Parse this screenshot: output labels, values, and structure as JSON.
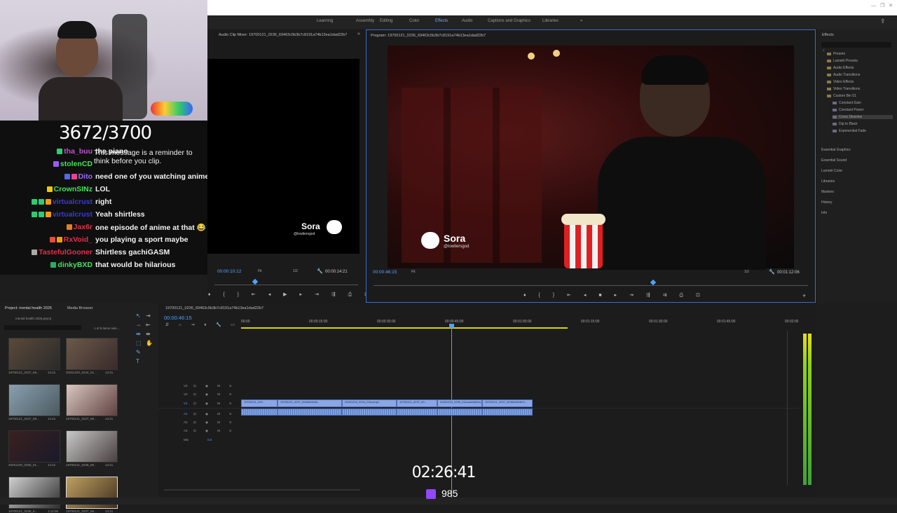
{
  "window": {
    "workspace_tabs": [
      "Learning",
      "Assembly",
      "Editing",
      "Color",
      "Effects",
      "Audio",
      "Captions and Graphics",
      "Libraries"
    ],
    "active_tab": "Effects",
    "more_label": "»"
  },
  "stream_overlay": {
    "follower_goal": "3672/3700",
    "uptime": "02:26:41",
    "viewers": "985"
  },
  "chat": [
    {
      "user": "tha_buu",
      "user_color": "#c44fd6",
      "message": "the piano",
      "badge_colors": [
        "#2ecc71"
      ]
    },
    {
      "user": "stolenCD",
      "user_color": "#42e35a",
      "message": "",
      "badge_colors": [
        "#9b59ff"
      ]
    },
    {
      "user": "Dito",
      "user_color": "#9b6bff",
      "message": "need one of you watching anime",
      "badge_colors": [
        "#5865f2",
        "#e84393"
      ]
    },
    {
      "user": "CrownSINz",
      "user_color": "#42e35a",
      "message": "LOL",
      "badge_colors": [
        "#f1c40f"
      ]
    },
    {
      "user": "virtualcrust",
      "user_color": "#3a3ad6",
      "message": "right",
      "badge_colors": [
        "#2ecc71",
        "#2ecc71",
        "#f39c12"
      ]
    },
    {
      "user": "virtualcrust",
      "user_color": "#3a3ad6",
      "message": "Yeah shirtless",
      "badge_colors": [
        "#2ecc71",
        "#2ecc71",
        "#f39c12"
      ]
    },
    {
      "user": "Jax6r",
      "user_color": "#e0304a",
      "message": "one episode of anime at that 😂",
      "badge_colors": [
        "#e67e22"
      ]
    },
    {
      "user": "RxVoid_",
      "user_color": "#e0304a",
      "message": "you playing a sport maybe",
      "badge_colors": [
        "#e74c3c",
        "#f39c12"
      ]
    },
    {
      "user": "TastefulGooner",
      "user_color": "#e0304a",
      "message": "Shirtless gachiGASM",
      "badge_colors": [
        "#aaaaaa"
      ]
    },
    {
      "user": "dinkyBXD",
      "user_color": "#42e35a",
      "message": "that would be hilarious",
      "badge_colors": [
        "#27ae60"
      ]
    }
  ],
  "chat_system_message": "This message is a reminder to think before you clip.",
  "source_monitor": {
    "title": "Audio Clip Mixer: 19700121_0236_69463c5b3b7c8191a74b13ea1dad22b7",
    "timecode": "00:00:10:12",
    "duration": "00:00:14:21",
    "zoom": "Fit",
    "quality": "1/2",
    "watermark_name": "Sora",
    "watermark_handle": "@lowtiersgod"
  },
  "program_monitor": {
    "title": "Program: 19700121_0236_69463c5b3b7c8191a74b13ea1dad22b7",
    "timecode": "00:00:46:15",
    "duration": "00:01:12:06",
    "zoom": "Fit",
    "quality": "1/2",
    "watermark_name": "Sora",
    "watermark_handle": "@lowtiersgod"
  },
  "effects_panel": {
    "title": "Effects",
    "tree": [
      "Presets",
      "Lumetri Presets",
      "Audio Effects",
      "Audio Transitions",
      "Video Effects",
      "Video Transitions",
      "Custom Bin 01",
      "Constant Gain",
      "Constant Power",
      "Cross Dissolve",
      "Dip to Black",
      "Exponential Fade"
    ],
    "sections": [
      "Essential Graphics",
      "Essential Sound",
      "Lumetri Color",
      "Libraries",
      "Markers",
      "History",
      "Info"
    ]
  },
  "project_panel": {
    "tabs": [
      "Project: mental health 2025",
      "Media Browser"
    ],
    "path": "mental health 2025.prproj",
    "items_count": "1 of 8 items sele...",
    "items": [
      {
        "name": "19700121_0237_69...",
        "duration": "14:21",
        "colors": [
          "#5a4a3a",
          "#2a2a2a"
        ]
      },
      {
        "name": "20251220_0244_01...",
        "duration": "14:21",
        "colors": [
          "#6a5a4a",
          "#3a2a2a"
        ]
      },
      {
        "name": "19700121_0237_69...",
        "duration": "14:21",
        "colors": [
          "#8aa0b0",
          "#4a5a60"
        ]
      },
      {
        "name": "19700121_0237_69...",
        "duration": "14:21",
        "colors": [
          "#d8c8c0",
          "#604040"
        ]
      },
      {
        "name": "20251220_0255_01...",
        "duration": "14:21",
        "colors": [
          "#3a2020",
          "#1a1a2a"
        ]
      },
      {
        "name": "19700121_0236_69...",
        "duration": "14:21",
        "colors": [
          "#c8c8c8",
          "#4a4040"
        ]
      },
      {
        "name": "19700121_0236_6...",
        "duration": "1:12:06",
        "colors": [
          "#d0d0d0",
          "#303030"
        ]
      },
      {
        "name": "19700121_0237_69...",
        "duration": "14:21",
        "colors": [
          "#c0a060",
          "#403020"
        ]
      }
    ]
  },
  "timeline": {
    "sequence_name": "19700121_0236_69463c5b3b7c8191a74b13ea1dad22b7",
    "timecode": "00:00:46:15",
    "ruler": [
      "00:00",
      "00:00:15:00",
      "00:00:30:00",
      "00:00:45:00",
      "00:01:00:00",
      "00:01:15:00",
      "00:01:30:00",
      "00:01:45:00",
      "00:02:00"
    ],
    "tracks": [
      "V3",
      "V2",
      "V1",
      "A1",
      "A2",
      "A3",
      "Mix"
    ],
    "mix_value": "0.0",
    "video_clips": [
      "19700121_023...",
      "19700121_0237_69463c5b3b...",
      "20251220_0244_01kcwnpf...",
      "19700121_0237_69...",
      "20251220_0255_01kcwst4ethba...",
      "19700121_0237_69463c5b3b7c..."
    ]
  },
  "colors": {
    "accent": "#3a8ef6",
    "clip": "#8aa6e6",
    "playhead": "#4aa3ff"
  }
}
